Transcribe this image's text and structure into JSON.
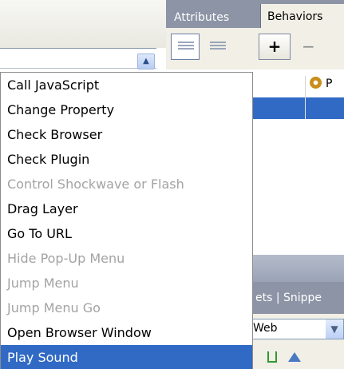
{
  "tabs": {
    "attributes": "Attributes",
    "behaviors": "Behaviors"
  },
  "toolbar": {
    "add_label": "+",
    "remove_label": "−"
  },
  "list": {
    "header_partial": "P"
  },
  "lower": {
    "tabs_partial": "ets | Snippe",
    "site_select_value": "Web"
  },
  "menu": {
    "items": [
      {
        "label": "Call JavaScript",
        "enabled": true
      },
      {
        "label": "Change Property",
        "enabled": true
      },
      {
        "label": "Check Browser",
        "enabled": true
      },
      {
        "label": "Check Plugin",
        "enabled": true
      },
      {
        "label": "Control Shockwave or Flash",
        "enabled": false
      },
      {
        "label": "Drag Layer",
        "enabled": true
      },
      {
        "label": "Go To URL",
        "enabled": true
      },
      {
        "label": "Hide Pop-Up Menu",
        "enabled": false
      },
      {
        "label": "Jump Menu",
        "enabled": false
      },
      {
        "label": "Jump Menu Go",
        "enabled": false
      },
      {
        "label": "Open Browser Window",
        "enabled": true
      },
      {
        "label": "Play Sound",
        "enabled": true,
        "highlighted": true
      }
    ]
  },
  "colors": {
    "selection": "#316ac5",
    "tab_strip": "#8c94a6",
    "disabled_text": "#a3a3a3"
  }
}
